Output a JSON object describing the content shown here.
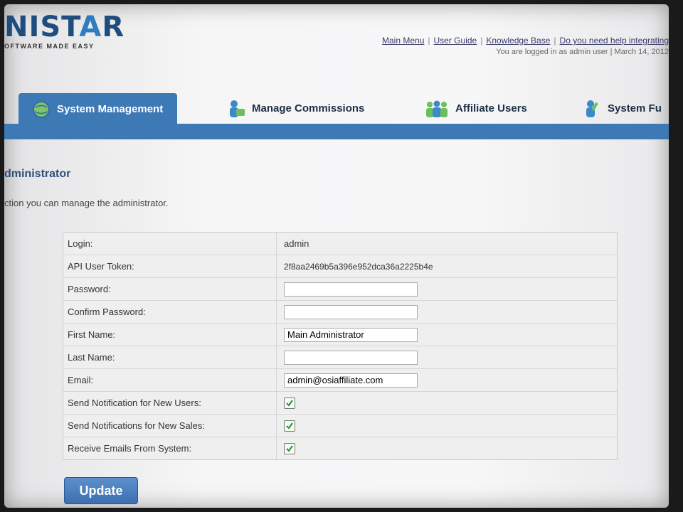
{
  "brand": {
    "name_main": "NIST",
    "name_accent": "A",
    "name_tail": "R",
    "tagline": "OFTWARE MADE EASY"
  },
  "header": {
    "links": [
      "Main Menu",
      "User Guide",
      "Knowledge Base",
      "Do you need help integrating"
    ],
    "login_status": "You are logged in as admin user | March 14, 2012"
  },
  "tabs": [
    {
      "label": "System Management",
      "icon": "gear-globe-icon",
      "active": true
    },
    {
      "label": "Manage Commissions",
      "icon": "money-person-icon",
      "active": false
    },
    {
      "label": "Affiliate Users",
      "icon": "users-group-icon",
      "active": false
    },
    {
      "label": "System Fu",
      "icon": "person-tool-icon",
      "active": false
    }
  ],
  "section": {
    "title": "dministrator",
    "description": "ction you can manage the administrator."
  },
  "form": {
    "login_label": "Login:",
    "login_value": "admin",
    "token_label": "API User Token:",
    "token_value": "2f8aa2469b5a396e952dca36a2225b4e",
    "password_label": "Password:",
    "password_value": "",
    "confirm_label": "Confirm Password:",
    "confirm_value": "",
    "first_name_label": "First Name:",
    "first_name_value": "Main Administrator",
    "last_name_label": "Last Name:",
    "last_name_value": "",
    "email_label": "Email:",
    "email_value": "admin@osiaffiliate.com",
    "notify_users_label": "Send Notification for New Users:",
    "notify_users_checked": true,
    "notify_sales_label": "Send Notifications for New Sales:",
    "notify_sales_checked": true,
    "receive_emails_label": "Receive Emails From System:",
    "receive_emails_checked": true
  },
  "update_label": "Update",
  "colors": {
    "tab_blue": "#3d79b5",
    "brand_dark": "#1f4d7d",
    "title_blue": "#2e4f78"
  }
}
